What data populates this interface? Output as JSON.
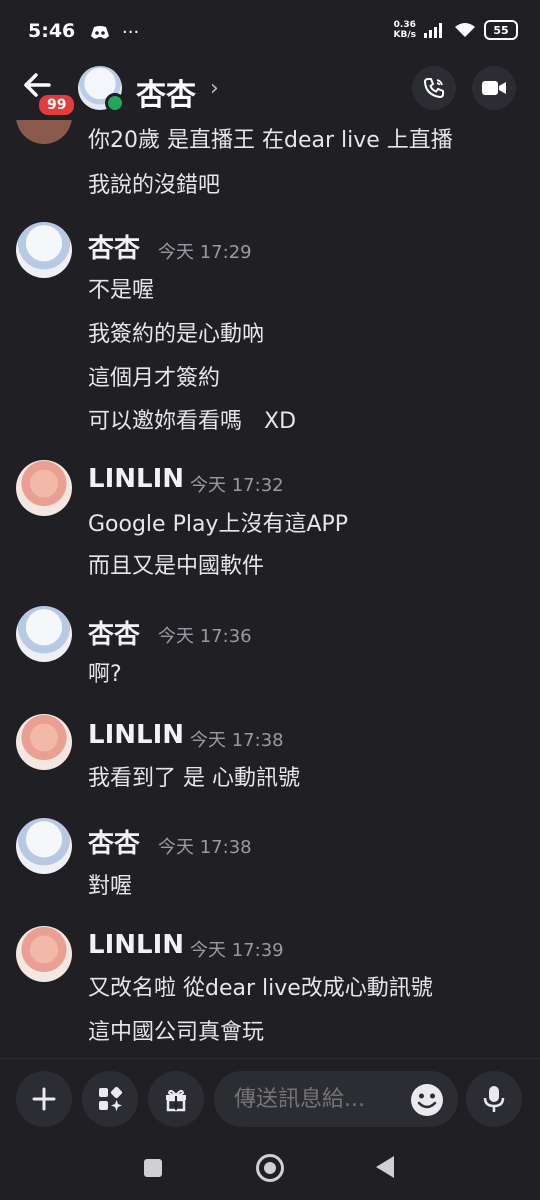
{
  "status_bar": {
    "time": "5:46",
    "more": "···",
    "net_speed_value": "0.36",
    "net_speed_unit": "KB/s",
    "battery": "55"
  },
  "header": {
    "unread_count": "99",
    "contact_name": "杏杏",
    "chevron": "›"
  },
  "messages": {
    "prev_line1": "你20歲 是直播王 在dear live 上直播",
    "prev_line2": "我說的沒錯吧",
    "group1": {
      "author": "杏杏",
      "time": "今天 17:29",
      "lines": [
        "不是喔",
        "我簽約的是心動吶",
        "這個月才簽約",
        "可以邀妳看看嗎　XD"
      ]
    },
    "group2": {
      "author": "LINLIN",
      "time": "今天 17:32",
      "lines": [
        "Google Play上沒有這APP",
        "而且又是中國軟件"
      ]
    },
    "group3": {
      "author": "杏杏",
      "time": "今天 17:36",
      "lines": [
        "啊?"
      ]
    },
    "group4": {
      "author": "LINLIN",
      "time": "今天 17:38",
      "lines": [
        "我看到了 是 心動訊號"
      ]
    },
    "group5": {
      "author": "杏杏",
      "time": "今天 17:38",
      "lines": [
        "對喔"
      ]
    },
    "group6": {
      "author": "LINLIN",
      "time": "今天 17:39",
      "lines": [
        "又改名啦 從dear live改成心動訊號",
        "這中國公司真會玩"
      ]
    }
  },
  "composer": {
    "placeholder": "傳送訊息給..."
  },
  "colors": {
    "background": "#1f1f24",
    "online": "#23a55a",
    "badge": "#e23c3f"
  }
}
